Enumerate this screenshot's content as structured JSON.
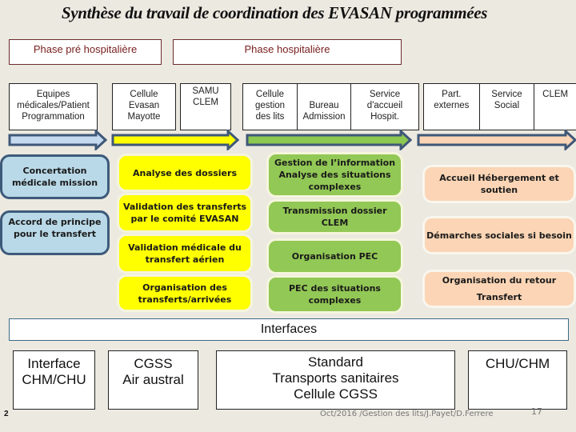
{
  "title": "Synthèse du travail de coordination des EVASAN programmées",
  "phases": {
    "pre": "Phase pré hospitalière",
    "hosp": "Phase hospitalière"
  },
  "headers": {
    "equipes": "Equipes\nmédicales/Patient\nProgrammation",
    "cellule_evasan": "Cellule\nEvasan\nMayotte",
    "samu": "SAMU\nCLEM",
    "cellule_gestion": "Cellule\ngestion\ndes lits",
    "bureau": "Bureau\nAdmission",
    "service_accueil": "Service\nd'accueil\nHospit.",
    "part_externes": "Part.\nexternes",
    "service_social": "Service\nSocial",
    "clem": "CLEM"
  },
  "arrows": {
    "colors": {
      "blue": "#c5d9ef",
      "yellow": "#ffff00",
      "green": "#8dc851",
      "peach": "#fbd5b5",
      "outline": "#3f5878"
    }
  },
  "columns": {
    "blue": [
      "Concertation\nmédicale mission",
      "Accord de principe\npour le transfert"
    ],
    "yellow": [
      "Analyse des dossiers",
      "Validation des transferts\npar le comité EVASAN",
      "Validation médicale du\ntransfert aérien",
      "Organisation des\ntransferts/arrivées"
    ],
    "green": [
      "Gestion de l’information\nAnalyse des situations\ncomplexes",
      "Transmission dossier CLEM",
      "Organisation PEC",
      "PEC des situations\ncomplexes"
    ],
    "peach": [
      "Accueil Hébergement  et\nsoutien",
      "Démarches sociales si besoin",
      "Organisation du retour\nTransfert"
    ]
  },
  "interfaces": {
    "label": "Interfaces",
    "boxes": [
      "Interface\nCHM/CHU",
      "CGSS\nAir austral",
      "Standard\nTransports sanitaires\nCellule CGSS",
      "CHU/CHM"
    ]
  },
  "footer": {
    "credit": "Oct/2016 /Gestion des lits/J.Payet/D.Ferrere",
    "page_number": "17",
    "left_mark": "2"
  }
}
